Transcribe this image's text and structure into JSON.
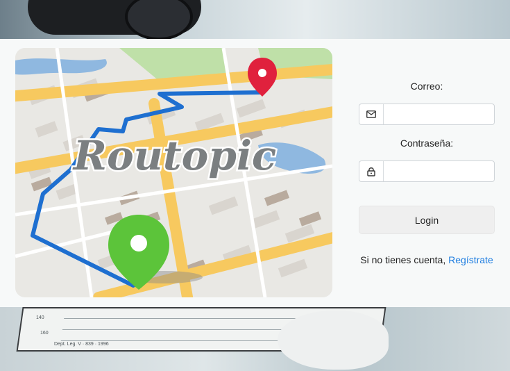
{
  "app": {
    "logo_text": "Routopic"
  },
  "login": {
    "email_label": "Correo:",
    "email_value": "",
    "password_label": "Contraseña:",
    "password_value": "",
    "login_button": "Login",
    "signup_prompt": "Si no tienes cuenta,",
    "signup_link": "Regístrate"
  },
  "icons": {
    "email": "envelope-icon",
    "password": "lock-icon",
    "destination": "map-pin-red-icon",
    "origin": "map-pin-green-icon"
  },
  "colors": {
    "route": "#1e6fd0",
    "pin_destination": "#e0213d",
    "pin_origin": "#5cc43a",
    "link": "#1e7de0"
  },
  "background": {
    "ruler_texts": [
      "140",
      "160",
      "Dept. Leg. V · 839 · 1996"
    ]
  }
}
